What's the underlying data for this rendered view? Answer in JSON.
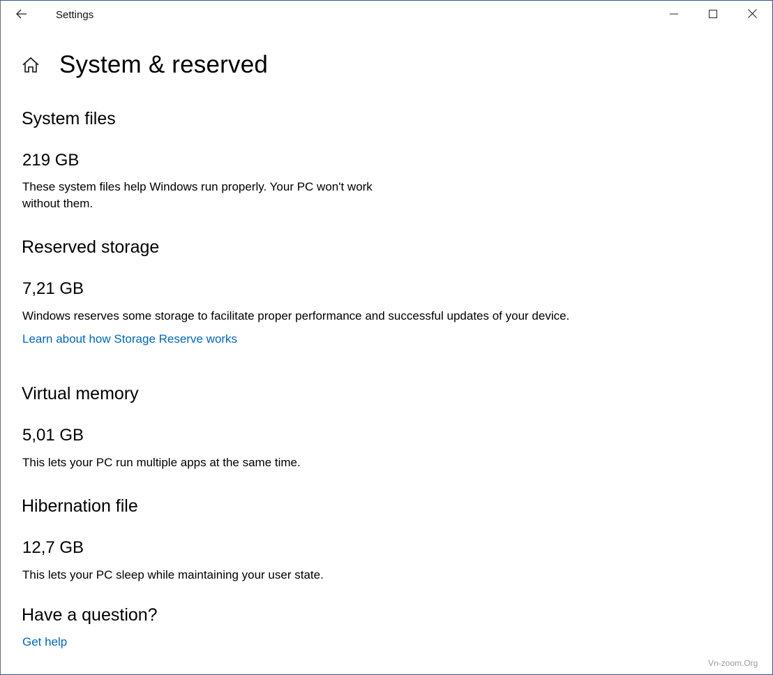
{
  "window": {
    "title": "Settings"
  },
  "page": {
    "title": "System & reserved"
  },
  "sections": {
    "system_files": {
      "title": "System files",
      "size": "219 GB",
      "desc_line1": "These system files help Windows run properly. Your PC won't work",
      "desc_line2": "without them."
    },
    "reserved": {
      "title": "Reserved storage",
      "size": "7,21 GB",
      "desc": "Windows reserves some storage to facilitate proper performance and successful updates of your device.",
      "link": "Learn about how Storage Reserve works"
    },
    "virtual_memory": {
      "title": "Virtual memory",
      "size": "5,01 GB",
      "desc": "This lets your PC run multiple apps at the same time."
    },
    "hibernation": {
      "title": "Hibernation file",
      "size": "12,7 GB",
      "desc": "This lets your PC sleep while maintaining your user state."
    }
  },
  "help": {
    "title": "Have a question?",
    "link": "Get help"
  },
  "watermark": "Vn-zoom.Org",
  "colors": {
    "link": "#0067b8",
    "border": "#2b5797"
  },
  "icons": {
    "back": "back-arrow-icon",
    "home": "home-icon",
    "minimize": "minimize-icon",
    "maximize": "maximize-icon",
    "close": "close-icon"
  }
}
